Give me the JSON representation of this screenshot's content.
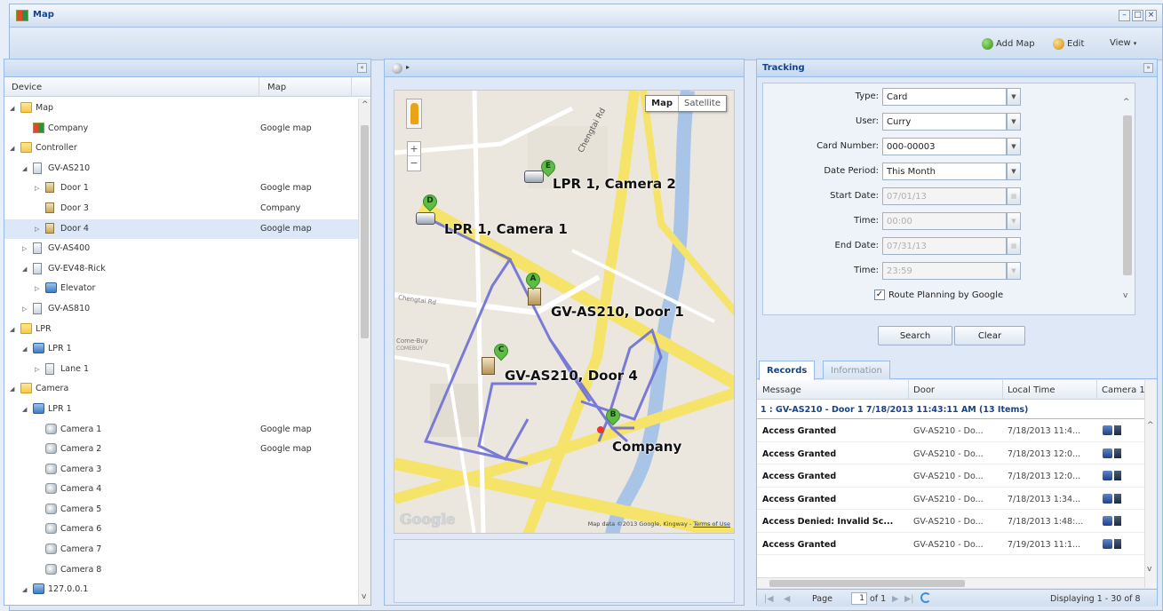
{
  "window": {
    "title": "Map"
  },
  "toolbar": {
    "add_map": "Add Map",
    "edit": "Edit",
    "view": "View"
  },
  "left_panel": {
    "columns": {
      "device": "Device",
      "map": "Map"
    },
    "tree": [
      {
        "label": "Map",
        "map": "",
        "icon": "folder-icon",
        "expand": "expanded",
        "level": 0
      },
      {
        "label": "Company",
        "map": "Google map",
        "icon": "map-icon",
        "expand": "none",
        "level": 1
      },
      {
        "label": "Controller",
        "map": "",
        "icon": "folder-icon",
        "expand": "expanded",
        "level": 0
      },
      {
        "label": "GV-AS210",
        "map": "",
        "icon": "controller-icon",
        "expand": "expanded",
        "level": 1
      },
      {
        "label": "Door 1",
        "map": "Google map",
        "icon": "door-icon",
        "expand": "collapsed",
        "level": 2
      },
      {
        "label": "Door 3",
        "map": "Company",
        "icon": "door-icon",
        "expand": "none",
        "level": 2
      },
      {
        "label": "Door 4",
        "map": "Google map",
        "icon": "door-icon",
        "expand": "collapsed",
        "level": 2,
        "selected": true
      },
      {
        "label": "GV-AS400",
        "map": "",
        "icon": "controller-icon",
        "expand": "collapsed",
        "level": 1
      },
      {
        "label": "GV-EV48-Rick",
        "map": "",
        "icon": "controller-icon",
        "expand": "expanded",
        "level": 1
      },
      {
        "label": "Elevator",
        "map": "",
        "icon": "elevator-icon",
        "expand": "collapsed",
        "level": 2
      },
      {
        "label": "GV-AS810",
        "map": "",
        "icon": "controller-icon",
        "expand": "collapsed",
        "level": 1
      },
      {
        "label": "LPR",
        "map": "",
        "icon": "folder-icon",
        "expand": "expanded",
        "level": 0
      },
      {
        "label": "LPR 1",
        "map": "",
        "icon": "lpr-icon",
        "expand": "expanded",
        "level": 1
      },
      {
        "label": "Lane 1",
        "map": "",
        "icon": "lane-icon",
        "expand": "collapsed",
        "level": 2
      },
      {
        "label": "Camera",
        "map": "",
        "icon": "folder-icon",
        "expand": "expanded",
        "level": 0
      },
      {
        "label": "LPR 1",
        "map": "",
        "icon": "network-icon",
        "expand": "expanded",
        "level": 1
      },
      {
        "label": "Camera 1",
        "map": "Google map",
        "icon": "camera-icon",
        "expand": "none",
        "level": 2
      },
      {
        "label": "Camera 2",
        "map": "Google map",
        "icon": "camera-icon",
        "expand": "none",
        "level": 2
      },
      {
        "label": "Camera 3",
        "map": "",
        "icon": "camera-icon",
        "expand": "none",
        "level": 2
      },
      {
        "label": "Camera 4",
        "map": "",
        "icon": "camera-icon",
        "expand": "none",
        "level": 2
      },
      {
        "label": "Camera 5",
        "map": "",
        "icon": "camera-icon",
        "expand": "none",
        "level": 2
      },
      {
        "label": "Camera 6",
        "map": "",
        "icon": "camera-icon",
        "expand": "none",
        "level": 2
      },
      {
        "label": "Camera 7",
        "map": "",
        "icon": "camera-icon",
        "expand": "none",
        "level": 2
      },
      {
        "label": "Camera 8",
        "map": "",
        "icon": "camera-icon",
        "expand": "none",
        "level": 2
      },
      {
        "label": "127.0.0.1",
        "map": "",
        "icon": "network-icon",
        "expand": "expanded",
        "level": 1
      }
    ]
  },
  "map": {
    "toggle_map": "Map",
    "toggle_satellite": "Satellite",
    "labels": {
      "camera2": "LPR 1, Camera 2",
      "camera1": "LPR 1, Camera 1",
      "door1": "GV-AS210, Door 1",
      "door4": "GV-AS210, Door 4",
      "company": "Company"
    },
    "markers": {
      "a": "A",
      "b": "B",
      "c": "C",
      "d": "D",
      "e": "E"
    },
    "streets": {
      "s1": "Chengtai Rd",
      "s2": "Chengtai Rd",
      "s3": "Come-Buy",
      "s4": "COMEBUY"
    },
    "logo": "Google",
    "credit": "Map data ©2013 Google, Kingway -",
    "terms": "Terms of Use"
  },
  "tracking": {
    "title": "Tracking",
    "fields": {
      "type_label": "Type:",
      "type": "Card",
      "user_label": "User:",
      "user": "Curry",
      "card_label": "Card Number:",
      "card": "000-00003",
      "period_label": "Date Period:",
      "period": "This Month",
      "start_label": "Start Date:",
      "start": "07/01/13",
      "time1_label": "Time:",
      "time1": "00:00",
      "end_label": "End Date:",
      "end": "07/31/13",
      "time2_label": "Time:",
      "time2": "23:59"
    },
    "route_planning": "Route Planning by Google",
    "route_checked": "✓",
    "search": "Search",
    "clear": "Clear",
    "tabs": {
      "records": "Records",
      "information": "Information"
    },
    "columns": {
      "message": "Message",
      "door": "Door",
      "local_time": "Local Time",
      "camera": "Camera 1"
    },
    "group": "1 : GV-AS210 - Door 1 7/18/2013 11:43:11 AM (13 Items)",
    "records": [
      {
        "message": "Access Granted",
        "door": "GV-AS210 - Do...",
        "time": "7/18/2013 11:4..."
      },
      {
        "message": "Access Granted",
        "door": "GV-AS210 - Do...",
        "time": "7/18/2013 12:0..."
      },
      {
        "message": "Access Granted",
        "door": "GV-AS210 - Do...",
        "time": "7/18/2013 12:0..."
      },
      {
        "message": "Access Granted",
        "door": "GV-AS210 - Do...",
        "time": "7/18/2013 1:34..."
      },
      {
        "message": "Access Denied: Invalid Sc...",
        "door": "GV-AS210 - Do...",
        "time": "7/18/2013 1:48:..."
      },
      {
        "message": "Access Granted",
        "door": "GV-AS210 - Do...",
        "time": "7/19/2013 11:1..."
      }
    ],
    "pager": {
      "page": "Page",
      "current": "1",
      "of": "of 1",
      "displaying": "Displaying 1 - 30 of 8"
    }
  }
}
